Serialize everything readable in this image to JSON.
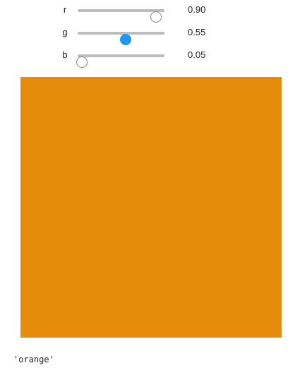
{
  "sliders": [
    {
      "label": "r",
      "value": 0.9,
      "value_text": "0.90",
      "knob_style": "hollow"
    },
    {
      "label": "g",
      "value": 0.55,
      "value_text": "0.55",
      "knob_style": "filled"
    },
    {
      "label": "b",
      "value": 0.05,
      "value_text": "0.05",
      "knob_style": "hollow"
    }
  ],
  "swatch": {
    "color": "#e68c0d"
  },
  "output": {
    "text": "'orange'"
  },
  "colors": {
    "track": "#bdbdbd",
    "accent": "#2196f3"
  }
}
